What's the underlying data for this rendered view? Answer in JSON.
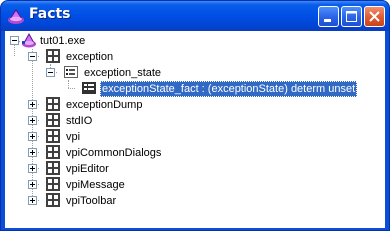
{
  "window": {
    "title": "Facts"
  },
  "tree": {
    "root": {
      "label": "tut01.exe"
    },
    "nodes": {
      "exception": {
        "label": "exception"
      },
      "exception_state": {
        "label": "exception_state"
      },
      "exception_state_fact": {
        "label": "exceptionState_fact : (exceptionState) determ unset"
      },
      "exceptionDump": {
        "label": "exceptionDump"
      },
      "stdIO": {
        "label": "stdIO"
      },
      "vpi": {
        "label": "vpi"
      },
      "vpiCommonDialogs": {
        "label": "vpiCommonDialogs"
      },
      "vpiEditor": {
        "label": "vpiEditor"
      },
      "vpiMessage": {
        "label": "vpiMessage"
      },
      "vpiToolbar": {
        "label": "vpiToolbar"
      }
    }
  }
}
